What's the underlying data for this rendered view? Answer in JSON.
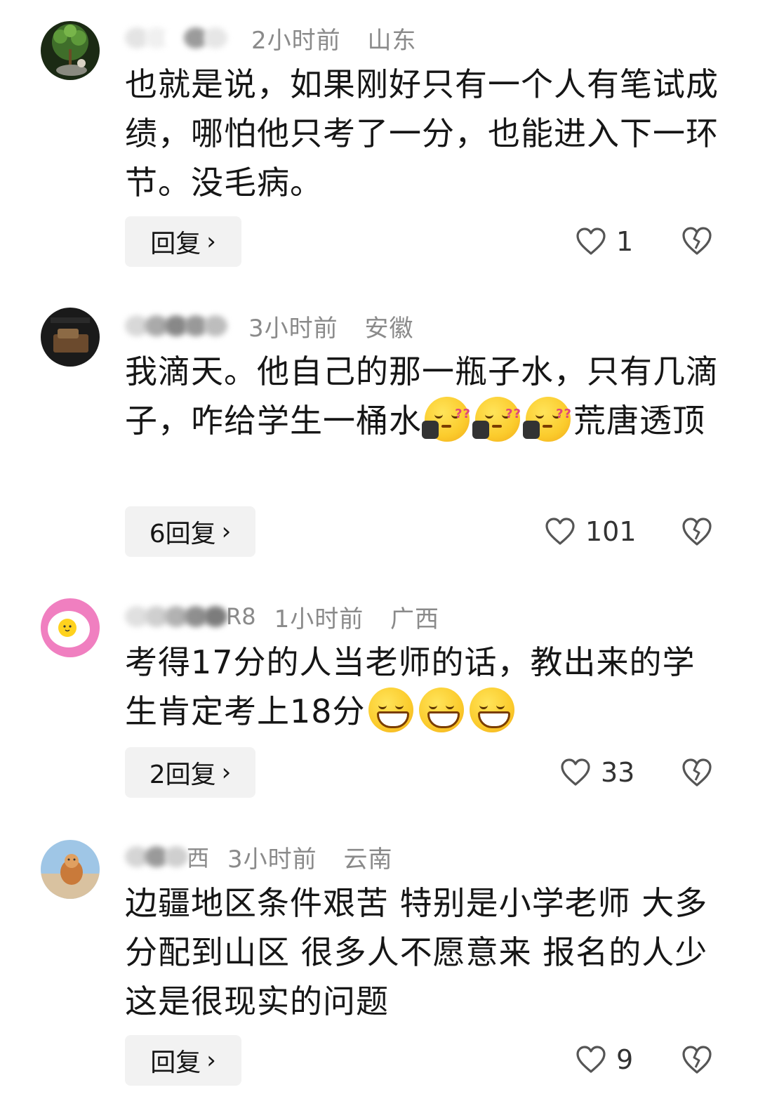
{
  "comments": [
    {
      "time": "2小时前",
      "location": "山东",
      "name_tail": "",
      "text": "也就是说，如果刚好只有一个人有笔试成绩，哪怕他只考了一分，也能进入下一环节。没毛病。",
      "reply_label": "回复",
      "likes": "1"
    },
    {
      "time": "3小时前",
      "location": "安徽",
      "name_tail": "",
      "text_part1": "我滴天。他自己的那一瓶子水，只有几滴子，咋给学生一桶水",
      "text_part2": "荒唐透顶",
      "emoji_name": "sleepy-emoji",
      "reply_label": "6回复",
      "likes": "101"
    },
    {
      "time": "1小时前",
      "location": "广西",
      "name_tail": "R8",
      "text_part1": "考得17分的人当老师的话，教出来的学生肯定考上18分",
      "emoji_name": "grin-emoji",
      "reply_label": "2回复",
      "likes": "33"
    },
    {
      "time": "3小时前",
      "location": "云南",
      "name_tail": "西",
      "text": "边疆地区条件艰苦 特别是小学老师 大多分配到山区 很多人不愿意来 报名的人少 这是很现实的问题",
      "reply_label": "回复",
      "likes": "9"
    }
  ],
  "icons": {
    "like": "heart-outline-icon",
    "dislike": "broken-heart-icon",
    "reply_chevron": "chevron-right-icon"
  },
  "reply_chevron": "›",
  "colors": {
    "meta_text": "#8a8a8a",
    "body_text": "#161616",
    "reply_bg": "#f2f2f2"
  }
}
